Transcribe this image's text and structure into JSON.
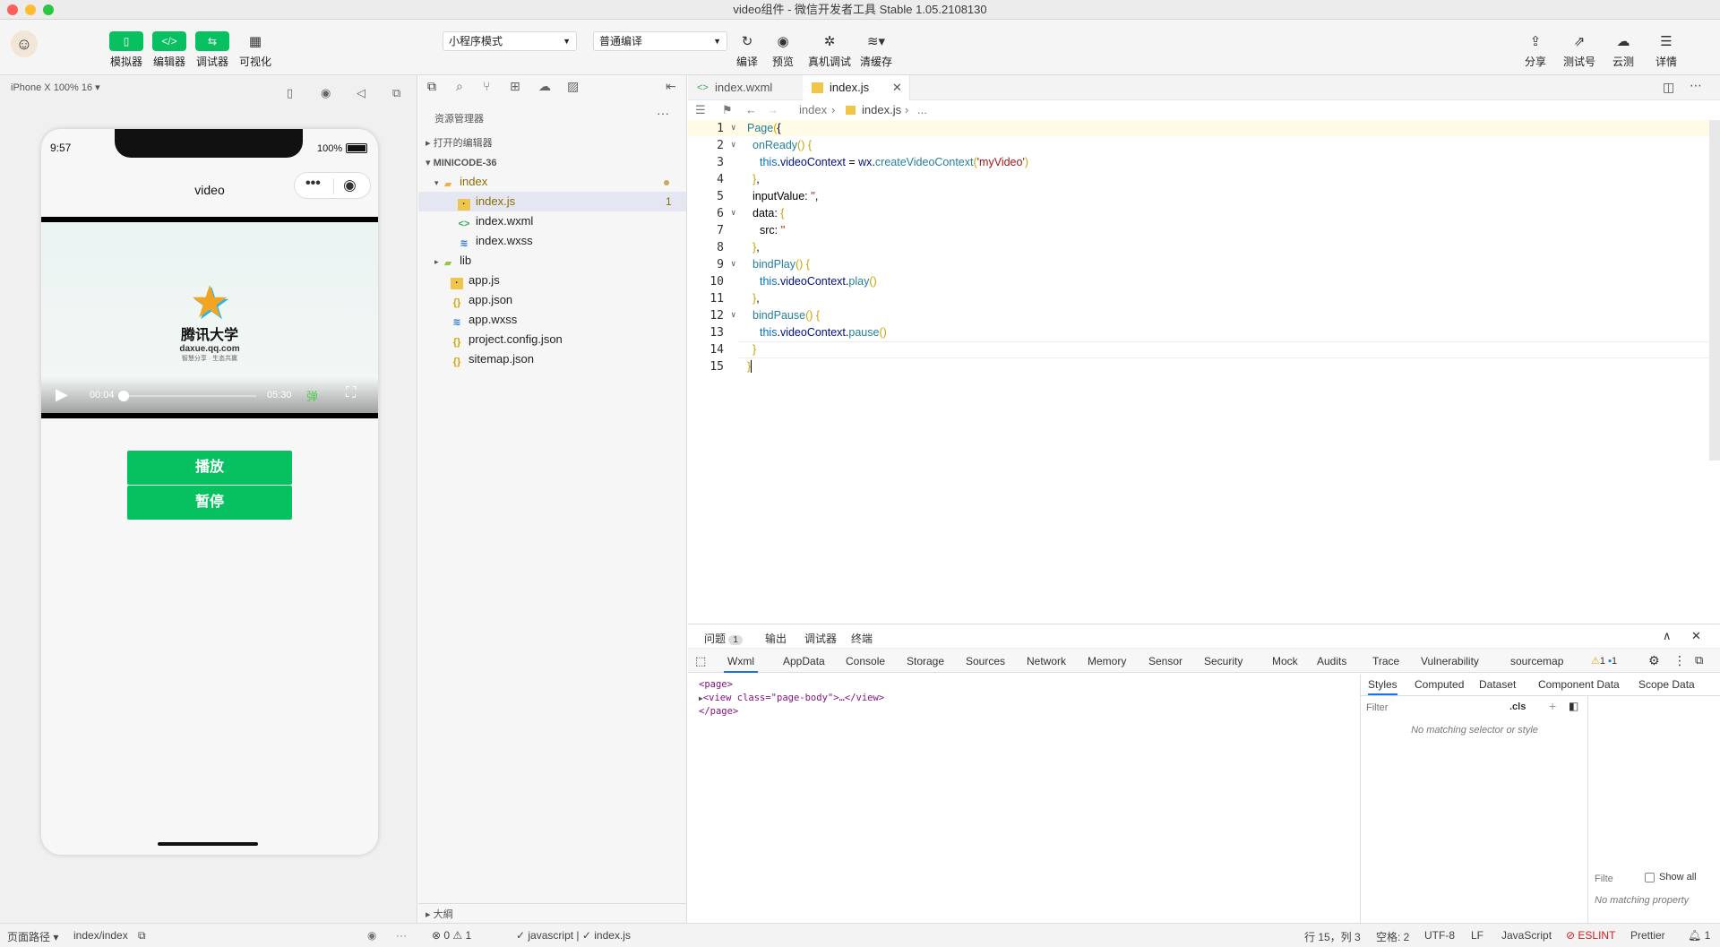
{
  "window": {
    "title": "video组件 - 微信开发者工具 Stable 1.05.2108130"
  },
  "toolbar": {
    "left": [
      {
        "icon": "phone-icon",
        "label": "模拟器"
      },
      {
        "icon": "code-icon",
        "label": "编辑器"
      },
      {
        "icon": "debug-icon",
        "label": "调试器"
      },
      {
        "icon": "layout-icon",
        "label": "可视化"
      }
    ],
    "mode_select": "小程序模式",
    "compile_select": "普通编译",
    "center": [
      {
        "icon": "refresh-icon",
        "label": "编译"
      },
      {
        "icon": "eye-icon",
        "label": "预览"
      },
      {
        "icon": "bug-icon",
        "label": "真机调试"
      },
      {
        "icon": "layers-icon",
        "label": "清缓存"
      }
    ],
    "right": [
      {
        "icon": "upload-icon",
        "label": "分享"
      },
      {
        "icon": "external-icon",
        "label": "测试号"
      },
      {
        "icon": "cloud-icon",
        "label": "云测"
      },
      {
        "icon": "menu-icon",
        "label": "详情"
      }
    ]
  },
  "simulator": {
    "device": "iPhone X 100% 16 ▾",
    "time": "9:57",
    "battery": "100%",
    "nav_title": "video",
    "logo_text": "腾讯大学",
    "logo_url": "daxue.qq.com",
    "logo_sub": "智慧分享 · 生态共赢",
    "current_time": "00:04",
    "duration": "05:30",
    "progress": 0.012,
    "play_button": "播放",
    "pause_button": "暂停"
  },
  "explorer": {
    "title": "资源管理器",
    "open_editors": "打开的编辑器",
    "project": "MINICODE-36",
    "tree": [
      {
        "name": "index",
        "type": "folder",
        "depth": 1,
        "open": true
      },
      {
        "name": "index.js",
        "type": "js",
        "depth": 2,
        "selected": true,
        "badge": "1"
      },
      {
        "name": "index.wxml",
        "type": "wxml",
        "depth": 2
      },
      {
        "name": "index.wxss",
        "type": "wxss",
        "depth": 2
      },
      {
        "name": "lib",
        "type": "folder",
        "depth": 1,
        "open": false
      },
      {
        "name": "app.js",
        "type": "js",
        "depth": 1
      },
      {
        "name": "app.json",
        "type": "json",
        "depth": 1
      },
      {
        "name": "app.wxss",
        "type": "wxss",
        "depth": 1
      },
      {
        "name": "project.config.json",
        "type": "json",
        "depth": 1
      },
      {
        "name": "sitemap.json",
        "type": "json",
        "depth": 1
      }
    ],
    "outline": "大綱"
  },
  "editor": {
    "tabs": [
      {
        "label": "index.wxml"
      },
      {
        "label": "index.js",
        "active": true
      }
    ],
    "breadcrumb": [
      "index",
      "index.js",
      "..."
    ],
    "lines": [
      "1",
      "2",
      "3",
      "4",
      "5",
      "6",
      "7",
      "8",
      "9",
      "10",
      "11",
      "12",
      "13",
      "14",
      "15"
    ]
  },
  "devtools": {
    "top_tabs": [
      "问题",
      "输出",
      "调试器",
      "终端"
    ],
    "problem_count": "1",
    "panel_tabs": [
      "Wxml",
      "AppData",
      "Console",
      "Storage",
      "Sources",
      "Network",
      "Memory",
      "Sensor",
      "Security",
      "Mock",
      "Audits",
      "Trace",
      "Vulnerability",
      "sourcemap"
    ],
    "warn_count": "1",
    "info_count": "1",
    "dom": [
      "<page>",
      "<view class=\"page-body\">…</view>",
      "</page>"
    ],
    "style_tabs": [
      "Styles",
      "Computed",
      "Dataset",
      "Component Data",
      "Scope Data"
    ],
    "filter_placeholder": "Filter",
    "cls": ".cls",
    "no_style": "No matching selector or style",
    "filter2": "Filte",
    "show_all": "Show all",
    "no_property": "No matching property"
  },
  "status": {
    "path_label": "页面路径 ▾",
    "path": "index/index",
    "errors": "0",
    "warnings": "1",
    "lang1": "javascript",
    "file": "index.js",
    "cursor": "行 15，列 3",
    "spaces": "空格: 2",
    "encoding": "UTF-8",
    "eol": "LF",
    "language": "JavaScript",
    "eslint": "ESLINT",
    "prettier": "Prettier",
    "notifications": "1"
  }
}
